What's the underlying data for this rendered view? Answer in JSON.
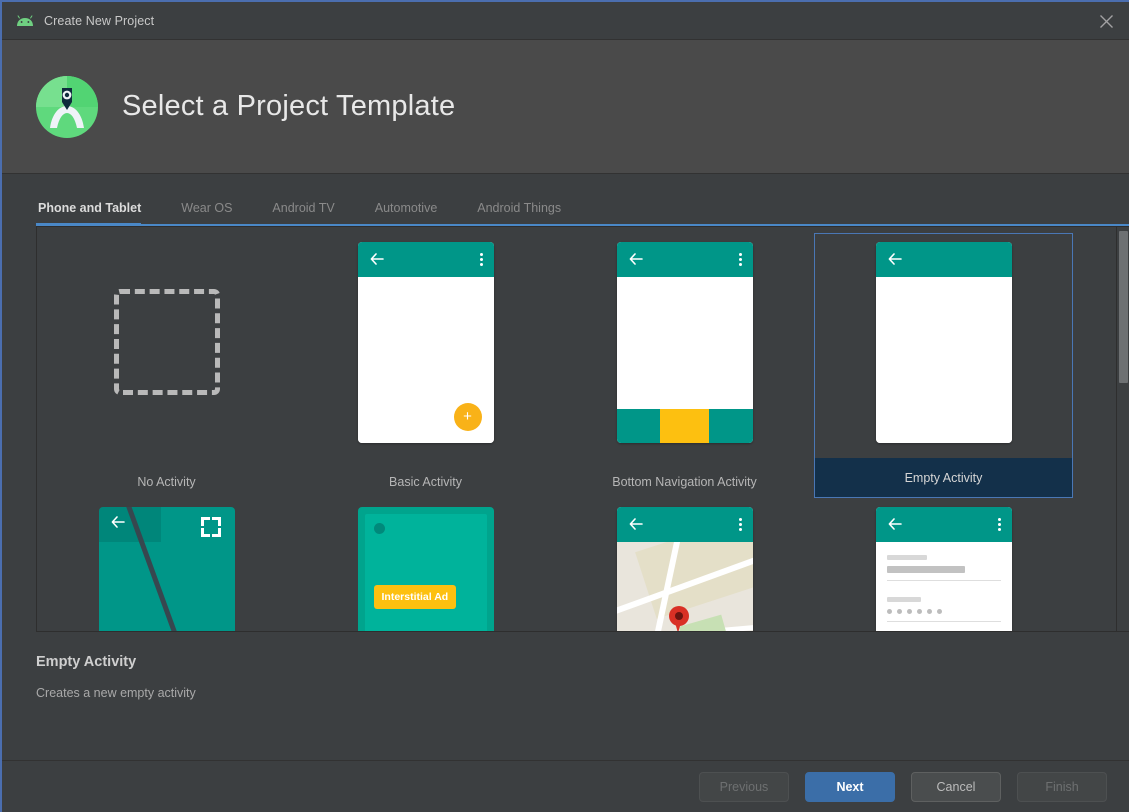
{
  "window": {
    "title": "Create New Project",
    "app_icon": "android-icon",
    "close_icon": "close-icon"
  },
  "header": {
    "title": "Select a Project Template",
    "logo_icon": "android-studio-logo"
  },
  "tabs": [
    {
      "label": "Phone and Tablet",
      "active": true
    },
    {
      "label": "Wear OS",
      "active": false
    },
    {
      "label": "Android TV",
      "active": false
    },
    {
      "label": "Automotive",
      "active": false
    },
    {
      "label": "Android Things",
      "active": false
    }
  ],
  "templates": [
    {
      "label": "No Activity",
      "thumb": "dashed-box",
      "selected": false
    },
    {
      "label": "Basic Activity",
      "thumb": "phone-fab",
      "selected": false
    },
    {
      "label": "Bottom Navigation Activity",
      "thumb": "phone-bottomnav",
      "selected": false
    },
    {
      "label": "Empty Activity",
      "thumb": "phone-empty",
      "selected": true
    },
    {
      "label": "",
      "thumb": "fullscreen",
      "selected": false
    },
    {
      "label": "",
      "thumb": "ad-interstitial",
      "selected": false
    },
    {
      "label": "",
      "thumb": "maps",
      "selected": false
    },
    {
      "label": "",
      "thumb": "login",
      "selected": false
    }
  ],
  "ad_card": {
    "badge": "Interstitial Ad"
  },
  "description": {
    "title": "Empty Activity",
    "text": "Creates a new empty activity"
  },
  "footer": {
    "previous": "Previous",
    "next": "Next",
    "cancel": "Cancel",
    "finish": "Finish"
  },
  "colors": {
    "accent_blue": "#4a88c7",
    "primary_button": "#3b6ea8",
    "selection_bg": "#13304a",
    "teal": "#009688",
    "amber": "#fdc010",
    "window_bg": "#3c3f41",
    "header_bg": "#4a4a4a"
  }
}
